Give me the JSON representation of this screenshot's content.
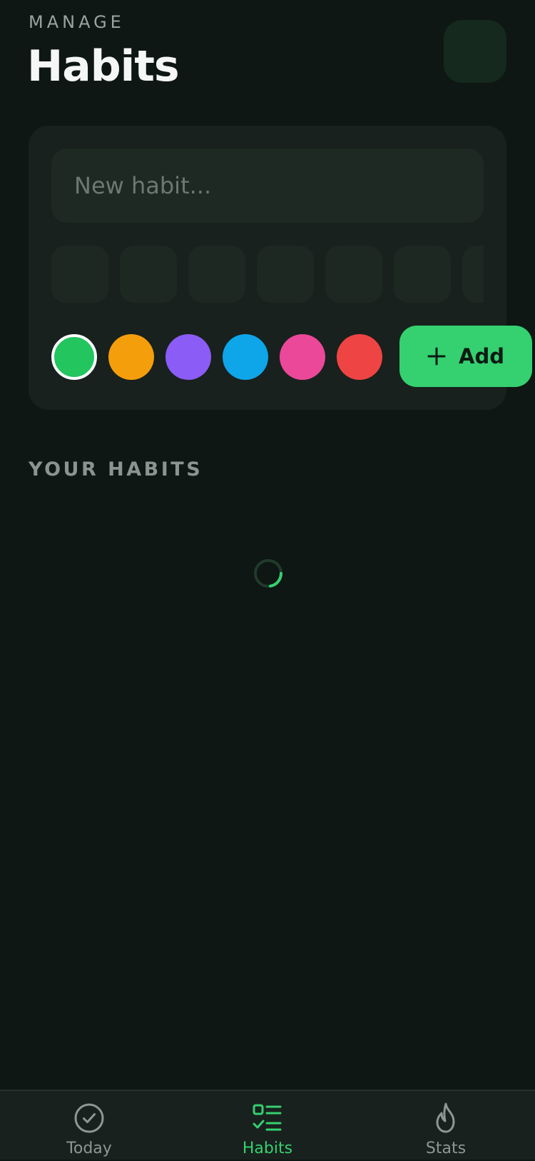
{
  "header": {
    "eyebrow": "MANAGE",
    "title": "Habits"
  },
  "new_habit": {
    "placeholder": "New habit...",
    "value": "",
    "add_label": "Add",
    "colors": [
      "#22c55e",
      "#f59e0b",
      "#8b5cf6",
      "#0ea5e9",
      "#ec4899",
      "#ef4444"
    ],
    "selected_color": "#22c55e"
  },
  "list": {
    "section_title": "YOUR HABITS",
    "state": "loading"
  },
  "nav": {
    "items": [
      {
        "label": "Today",
        "icon": "check-circle-icon"
      },
      {
        "label": "Habits",
        "icon": "habit-list-icon",
        "active": true
      },
      {
        "label": "Stats",
        "icon": "flame-icon"
      }
    ]
  },
  "colors": {
    "background": "#0e1714",
    "card": "#18211d",
    "accent": "#35d070",
    "muted_text": "#8e9792"
  }
}
